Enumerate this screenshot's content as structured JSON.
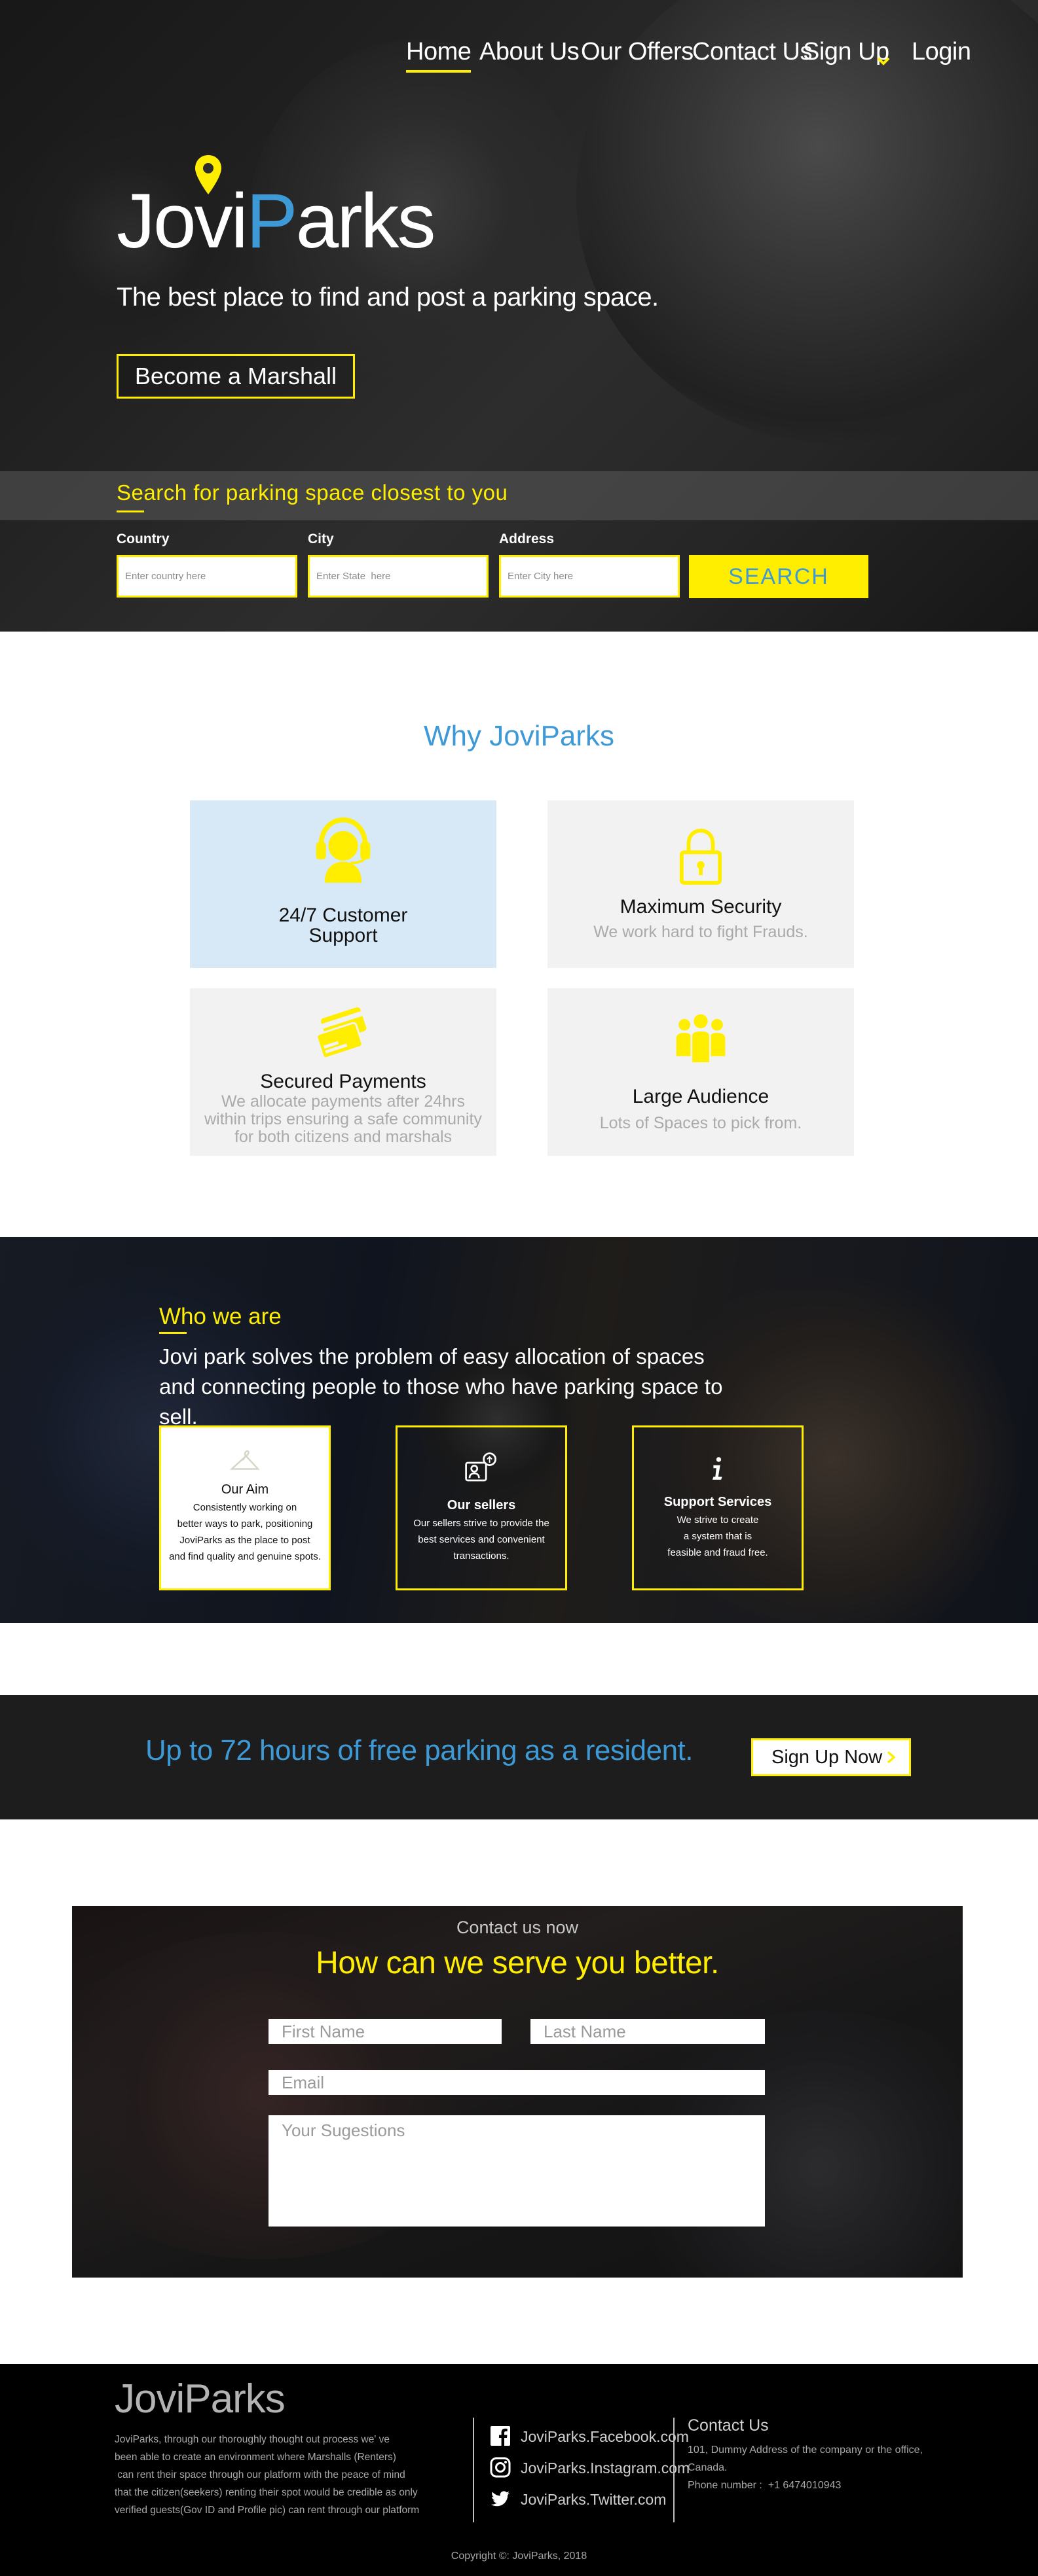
{
  "nav": {
    "items": [
      {
        "label": "Home",
        "active": true
      },
      {
        "label": "About Us"
      },
      {
        "label": "Our Offers"
      },
      {
        "label": "Contact Us"
      },
      {
        "label": "Sign Up"
      },
      {
        "label": "Login"
      }
    ]
  },
  "hero": {
    "logo_part1": "Jovi",
    "logo_p": "P",
    "logo_part2": "arks",
    "tagline": "The best place to find and post a parking space.",
    "cta_label": "Become a Marshall"
  },
  "search": {
    "title": "Search for parking space closest to you",
    "fields": [
      {
        "label": "Country",
        "placeholder": "Enter country here"
      },
      {
        "label": "City",
        "placeholder": "Enter State  here"
      },
      {
        "label": "Address",
        "placeholder": "Enter City here"
      }
    ],
    "button_label": "SEARCH"
  },
  "why": {
    "title": "Why JoviParks",
    "cards": [
      {
        "title": "24/7 Customer Support",
        "title_line1": "24/7 Customer",
        "title_line2": "Support",
        "subtitle": "",
        "icon": "headset-icon"
      },
      {
        "title": "Maximum Security",
        "subtitle": "We work hard to fight Frauds.",
        "icon": "lock-icon"
      },
      {
        "title": "Secured Payments",
        "subtitle_lines": [
          "We allocate payments after 24hrs",
          "within trips ensuring a safe community",
          "for both citizens and marshals"
        ],
        "icon": "credit-cards-icon"
      },
      {
        "title": "Large Audience",
        "subtitle": "Lots of Spaces to pick from.",
        "icon": "group-icon"
      }
    ]
  },
  "who": {
    "title": "Who we are",
    "text_line1": "Jovi park solves the problem of easy allocation of spaces",
    "text_line2": "and connecting  people to those who have parking space to sell.",
    "boxes": [
      {
        "title": "Our Aim",
        "lines": [
          "Consistently working on",
          "better ways to park, positioning",
          "JoviParks as the place to post",
          "and find quality and genuine spots."
        ],
        "icon": "hanger-icon"
      },
      {
        "title": "Our sellers",
        "lines": [
          "Our sellers strive to provide the",
          "best services and convenient",
          "transactions."
        ],
        "icon": "seller-icon"
      },
      {
        "title": "Support Services",
        "lines": [
          "We strive to create",
          "a system that is",
          "feasible and fraud free."
        ],
        "icon": "info-icon"
      }
    ]
  },
  "promo": {
    "text": "Up to 72 hours of free parking as a resident.",
    "button_label": "Sign Up Now"
  },
  "contact": {
    "kicker": "Contact us now",
    "title": "How can we serve you better.",
    "first_name_placeholder": "First Name",
    "last_name_placeholder": "Last Name",
    "email_placeholder": "Email",
    "suggestions_placeholder": "Your Sugestions"
  },
  "footer": {
    "logo": "JoviParks",
    "about_lines": [
      "JoviParks, through our thoroughly thought out process we' ve",
      "been able to create an environment where Marshalls (Renters)",
      " can rent their space through our platform with the peace of mind",
      "that the citizen(seekers) renting their spot would be credible as only",
      "verified guests(Gov ID and Profile pic) can rent through our platform"
    ],
    "social": [
      {
        "label": "JoviParks.Facebook.com",
        "icon": "facebook-icon"
      },
      {
        "label": "JoviParks.Instagram.com",
        "icon": "instagram-icon"
      },
      {
        "label": "JoviParks.Twitter.com",
        "icon": "twitter-icon"
      }
    ],
    "contact_heading": "Contact Us",
    "contact_lines": [
      "101, Dummy Address of the company or the office,",
      "Canada.",
      "Phone number :  +1 6474010943"
    ],
    "copyright": "Copyright ©: JoviParks, 2018"
  },
  "colors": {
    "accent_yellow": "#ffee00",
    "accent_blue": "#3e9ad6",
    "dark_band": "#1d1d1d",
    "footer_bg": "#000000"
  }
}
